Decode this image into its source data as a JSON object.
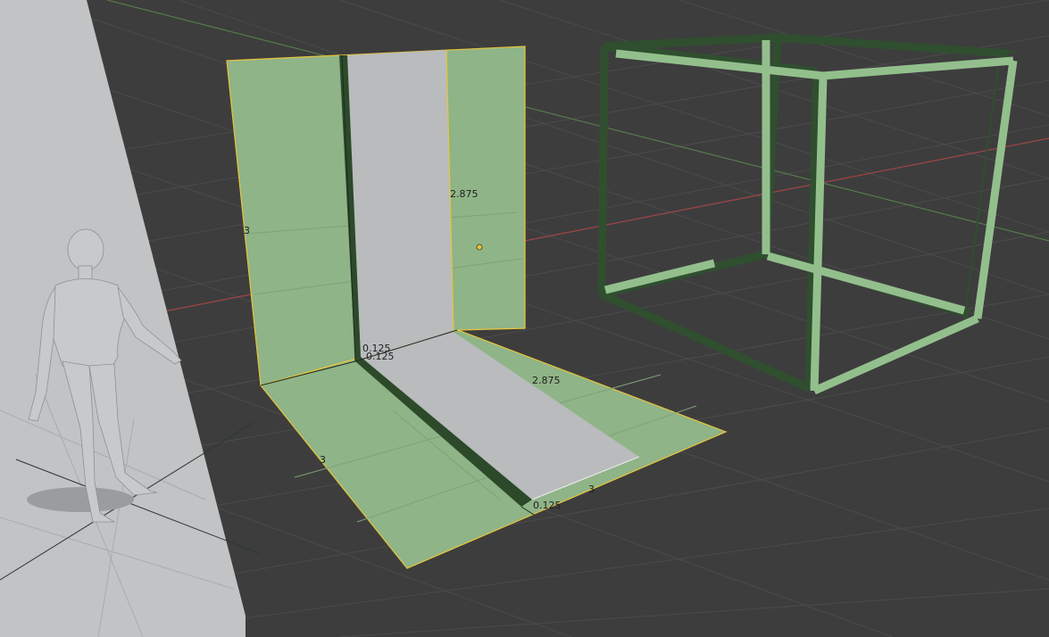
{
  "viewport": {
    "background_color": "#3d3d3d",
    "grid_color": "#4a4a4a",
    "x_axis_color": "#b34848",
    "y_axis_color": "#5e8a52",
    "selection_fill": "#a9d6a3",
    "selection_outline": "#f0c61e",
    "mesh_color": "#c2c4c6",
    "wireframe_dark": "#2f4f2f",
    "wireframe_light": "#93bf8d"
  },
  "dimensions": {
    "back_height": "3",
    "back_inner_height": "2.875",
    "corner_thickness_a": "0.125",
    "corner_thickness_b": "0.125",
    "floor_inner_depth": "2.875",
    "floor_depth": "3",
    "floor_width": "3",
    "floor_thickness": "0.125"
  },
  "objects": [
    "human-figure",
    "reference-plane",
    "corner-wall-mesh",
    "wire-cube"
  ]
}
